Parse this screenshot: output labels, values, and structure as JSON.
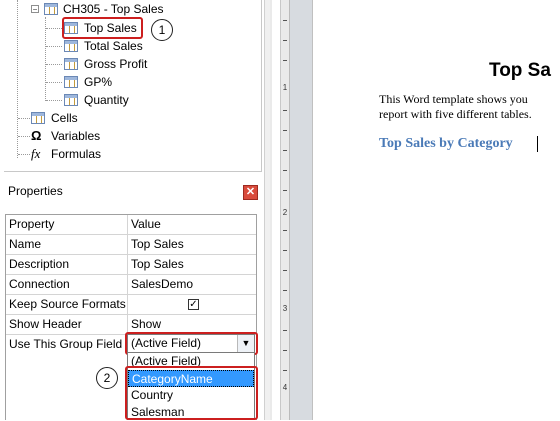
{
  "tree": {
    "root_label": "CH305 -  Top Sales",
    "tables": [
      {
        "label": "Top Sales"
      },
      {
        "label": "Total Sales"
      },
      {
        "label": "Gross Profit"
      },
      {
        "label": "GP%"
      },
      {
        "label": "Quantity"
      }
    ],
    "cells_label": "Cells",
    "variables_label": "Variables",
    "formulas_label": "Formulas"
  },
  "callouts": {
    "one": "1",
    "two": "2"
  },
  "properties": {
    "title": "Properties",
    "close_glyph": "✕",
    "header": {
      "property": "Property",
      "value": "Value"
    },
    "rows": [
      {
        "property": "Name",
        "value": "Top Sales"
      },
      {
        "property": "Description",
        "value": "Top Sales"
      },
      {
        "property": "Connection",
        "value": "SalesDemo"
      },
      {
        "property": "Keep Source Formats",
        "value": "✓"
      },
      {
        "property": "Show Header",
        "value": "Show"
      },
      {
        "property": "Use This Group Field",
        "value": "(Active Field)"
      }
    ],
    "dropdown_options": [
      "(Active Field)",
      "CategoryName",
      "Country",
      "Salesman"
    ],
    "selected_option": "CategoryName"
  },
  "ruler": {
    "numbers": [
      "1",
      "2",
      "3",
      "4"
    ]
  },
  "document": {
    "title": "Top Sa",
    "line1": "This Word template shows you",
    "line2": "report with five different tables.",
    "heading": "Top Sales by Category"
  },
  "colors": {
    "highlight": "#cc1f1f",
    "selection": "#3399ff",
    "heading": "#4a7ab7"
  }
}
